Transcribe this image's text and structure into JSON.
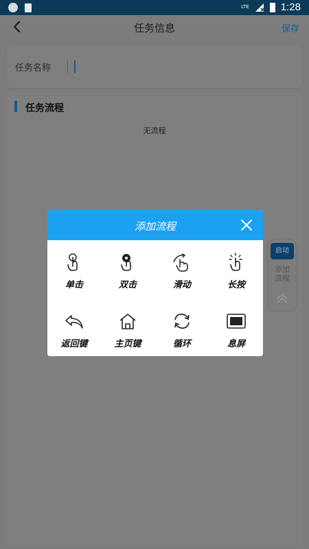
{
  "status_bar": {
    "network": "LTE",
    "time": "1:28"
  },
  "header": {
    "title": "任务信息",
    "save_label": "保存"
  },
  "task_name": {
    "label": "任务名称",
    "value": ""
  },
  "flow_section": {
    "title": "任务流程",
    "empty_text": "无流程"
  },
  "float_panel": {
    "start_label": "启动",
    "add_flow_label": "添加流程"
  },
  "dialog": {
    "title": "添加流程",
    "items": [
      {
        "label": "单击",
        "icon": "single-tap-icon"
      },
      {
        "label": "双击",
        "icon": "double-tap-icon"
      },
      {
        "label": "滑动",
        "icon": "swipe-icon"
      },
      {
        "label": "长按",
        "icon": "long-press-icon"
      },
      {
        "label": "返回键",
        "icon": "back-key-icon"
      },
      {
        "label": "主页键",
        "icon": "home-key-icon"
      },
      {
        "label": "循环",
        "icon": "loop-icon"
      },
      {
        "label": "息屏",
        "icon": "screen-off-icon"
      }
    ]
  },
  "colors": {
    "accent": "#1ba0f2",
    "status_bar": "#0c3a57",
    "overlay_bg": "#7c7c7c",
    "primary_dark": "#1b5a86"
  }
}
